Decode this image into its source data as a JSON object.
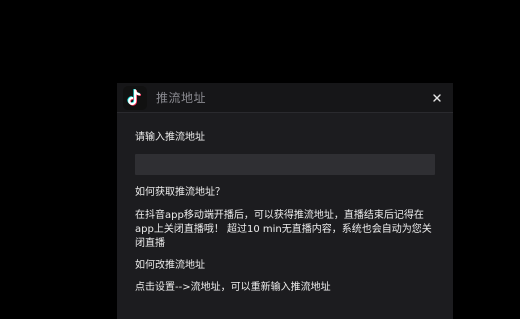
{
  "dialog": {
    "title": "推流地址",
    "logo_icon": "tiktok-logo-icon",
    "close_icon": "close-icon",
    "input_label": "请输入推流地址",
    "url_input": {
      "value": "",
      "placeholder": ""
    },
    "help_heading": "如何获取推流地址？",
    "help_text": "在抖音app移动端开播后，可以获得推流地址，直播结束后记得在app上关闭直播哦！ 超过10 min无直播内容，系统也会自动为您关闭直播",
    "change_heading": "如何改推流地址",
    "change_text": "点击设置-->流地址，可以重新输入推流地址"
  },
  "colors": {
    "background": "#000000",
    "dialog_bg": "#1c1c1f",
    "titlebar_bg": "#161618",
    "input_bg": "#2f2f33",
    "text": "#ececec",
    "title_text": "#8a8a90",
    "logo_cyan": "#25f4ee",
    "logo_red": "#fe2c55"
  }
}
